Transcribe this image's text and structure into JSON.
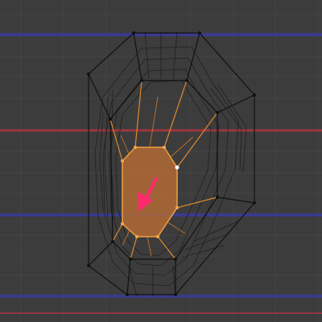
{
  "viewport": {
    "mode": "edit",
    "selection": "face-loop",
    "annotation": "arrow",
    "colors": {
      "background": "#3c3c3c",
      "grid": "#434343",
      "x_axis": "#9a3a44",
      "y_axis": "#3c3a8e",
      "wire": "#101010",
      "selected_face": "#b06a35",
      "selected_edge": "#f0a040",
      "active_vertex": "#ffffff",
      "arrow": "#ff2a6e"
    }
  }
}
